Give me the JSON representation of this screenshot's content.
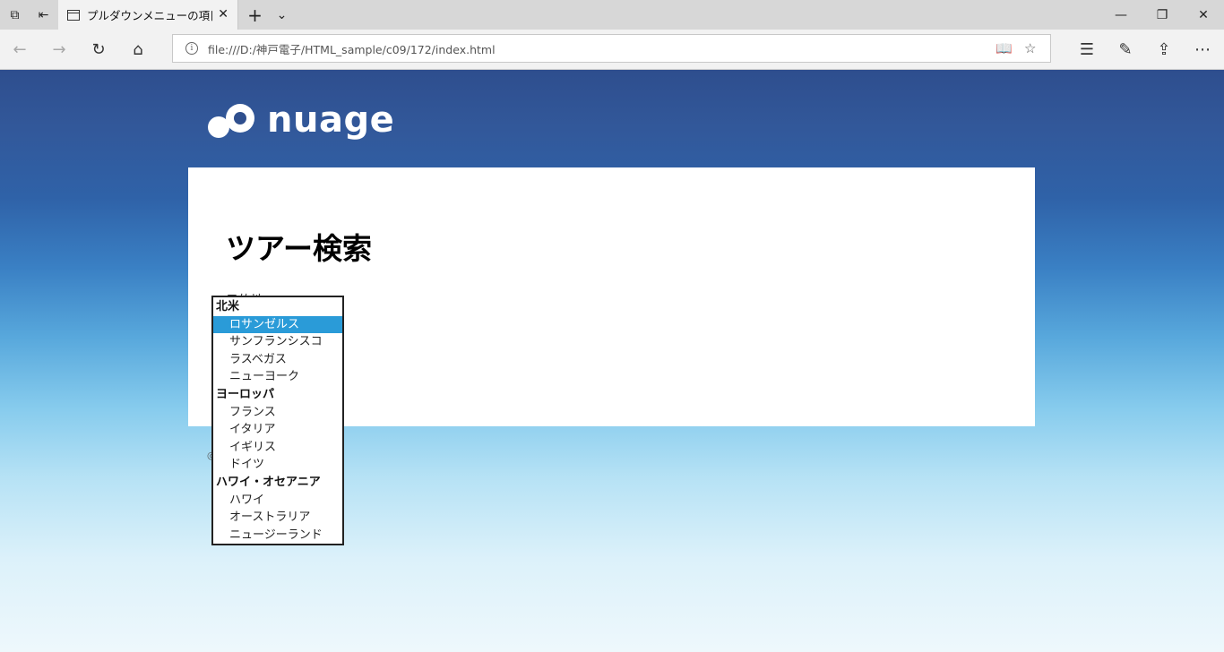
{
  "browser": {
    "tab_title": "プルダウンメニューの項目を:",
    "url": "file:///D:/神戸電子/HTML_sample/c09/172/index.html"
  },
  "page": {
    "logo_text": "nuage",
    "title": "ツアー検索",
    "field_label": "目的地"
  },
  "dropdown": {
    "groups": [
      {
        "label": "北米",
        "options": [
          "ロサンゼルス",
          "サンフランシスコ",
          "ラスベガス",
          "ニューヨーク"
        ]
      },
      {
        "label": "ヨーロッパ",
        "options": [
          "フランス",
          "イタリア",
          "イギリス",
          "ドイツ"
        ]
      },
      {
        "label": "ハワイ・オセアニア",
        "options": [
          "ハワイ",
          "オーストラリア",
          "ニュージーランド"
        ]
      }
    ],
    "selected": "ロサンゼルス"
  },
  "colors": {
    "selected_bg": "#2a9bd8",
    "sky_top": "#2e4e8e",
    "sky_bottom": "#eef8fc"
  }
}
